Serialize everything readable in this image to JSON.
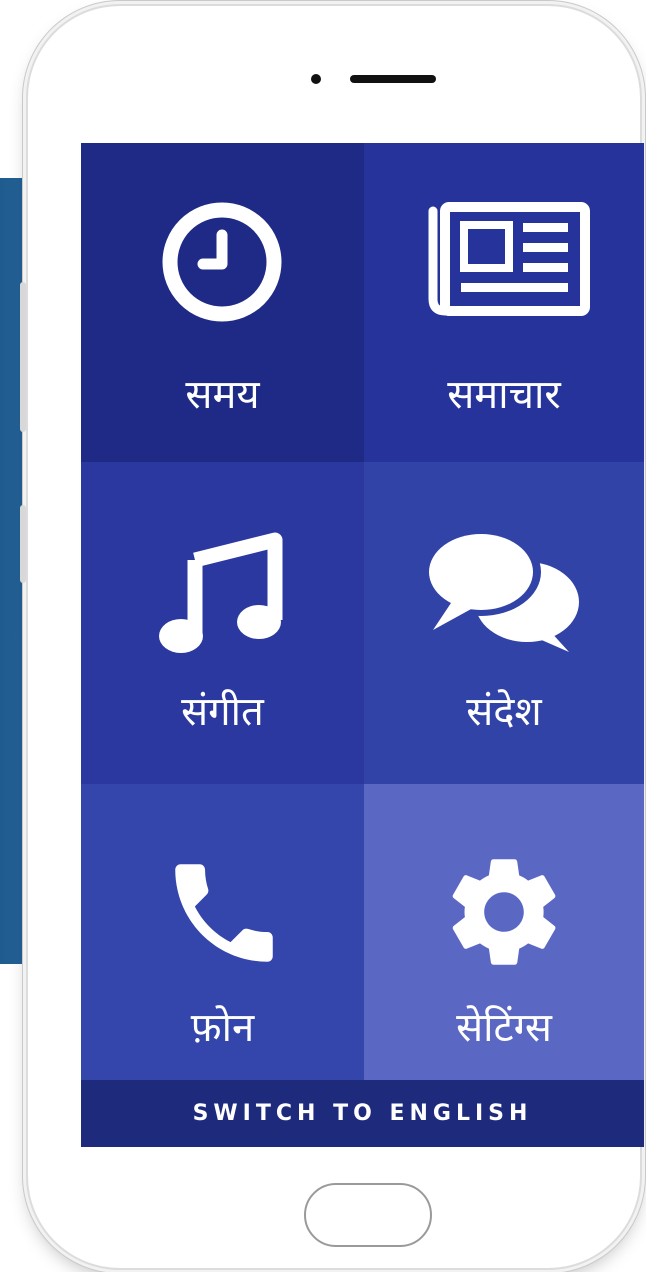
{
  "tiles": [
    {
      "label": "समय",
      "icon": "clock-icon",
      "bg": "#1e2a86"
    },
    {
      "label": "समाचार",
      "icon": "newspaper-icon",
      "bg": "#26339a"
    },
    {
      "label": "संगीत",
      "icon": "music-note-icon",
      "bg": "#2a389f"
    },
    {
      "label": "संदेश",
      "icon": "chat-bubbles-icon",
      "bg": "#3143a7"
    },
    {
      "label": "फ़ोन",
      "icon": "phone-icon",
      "bg": "#3445ab"
    },
    {
      "label": "सेटिंग्स",
      "icon": "gear-icon",
      "bg": "#5a68c4"
    }
  ],
  "footer": {
    "switch_label": "SWITCH TO ENGLISH",
    "bg": "#1e2b7c"
  },
  "colors": {
    "band": "#2f78b6",
    "screen": "#2a3a9b",
    "icon": "#ffffff"
  }
}
